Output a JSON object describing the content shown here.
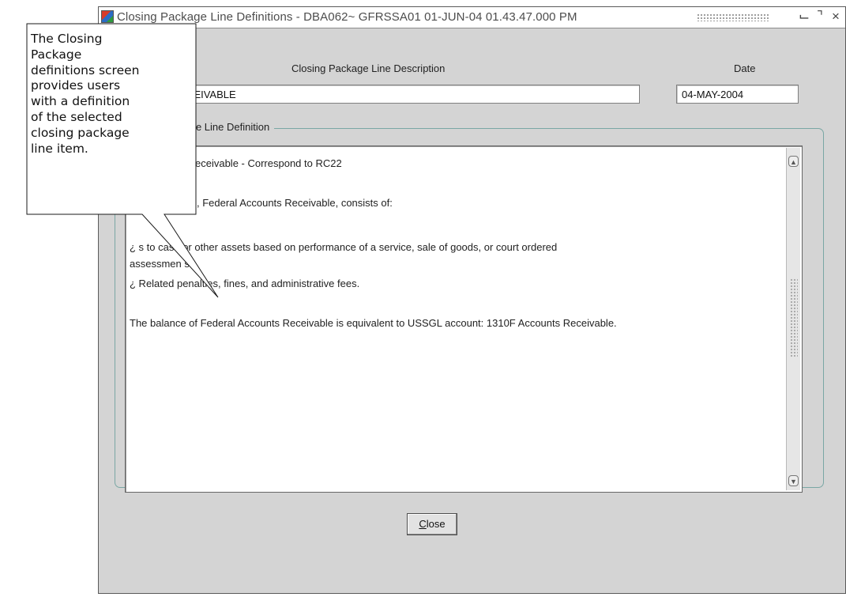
{
  "window": {
    "title": "Closing Package Line Definitions - DBA062~ GFRSSA01  01-JUN-04 01.43.47.000 PM",
    "minimize_glyph": "⌙",
    "maximize_glyph": "⌝",
    "close_glyph": "×"
  },
  "headers": {
    "description": "Closing Package Line Description",
    "date": "Date"
  },
  "fields": {
    "description_value": "RECEIVABLE",
    "date_value": "04-MAY-2004"
  },
  "definition_group": {
    "legend": "kage Line Definition",
    "lines": [
      "eceivable - Correspond to RC22",
      ", Federal Accounts Receivable, consists of:",
      "¿       s to cash or other assets based on performance of a service, sale of goods, or court ordered",
      "assessmen s.",
      "¿     Related penalties, fines, and administrative fees.",
      "The balance of Federal Accounts Receivable is equivalent to USSGL account: 1310F Accounts Receivable."
    ]
  },
  "scrollbar": {
    "up_icon": "up-arrow-icon",
    "down_icon": "down-arrow-icon"
  },
  "buttons": {
    "close_mnemonic": "C",
    "close_rest": "lose"
  },
  "callout": {
    "lines": [
      "The Closing",
      "Package",
      "definitions screen",
      "provides users",
      "with a definition",
      "of the selected",
      "closing package",
      "line item."
    ]
  }
}
